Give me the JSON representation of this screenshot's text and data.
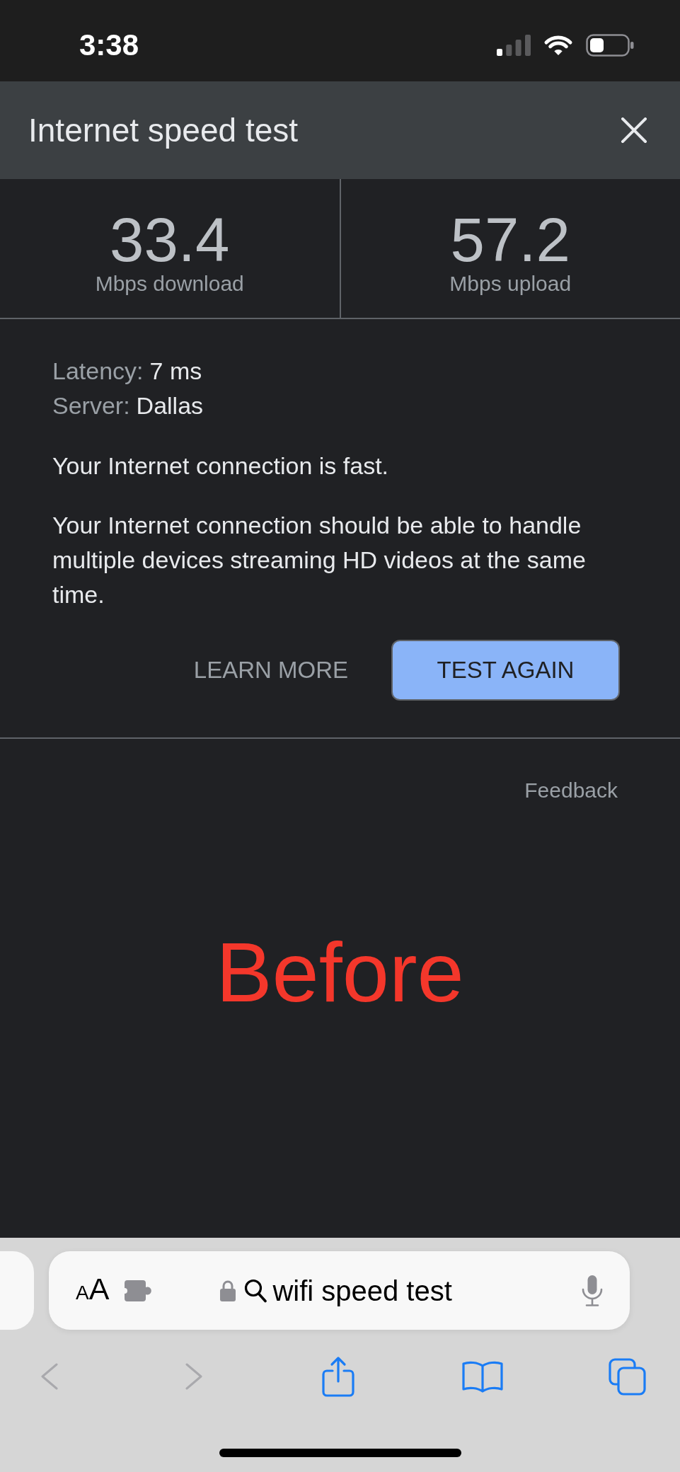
{
  "status_bar": {
    "time": "3:38"
  },
  "speed_test": {
    "title": "Internet speed test",
    "results": [
      {
        "value": "33.4",
        "unit": "Mbps download"
      },
      {
        "value": "57.2",
        "unit": "Mbps upload"
      }
    ],
    "details": [
      {
        "label": "Latency:",
        "value": "7 ms"
      },
      {
        "label": "Server:",
        "value": "Dallas"
      }
    ],
    "verdict": "Your Internet connection is fast.",
    "description": "Your Internet connection should be able to handle multiple devices streaming HD videos at the same time.",
    "buttons": [
      {
        "label": "LEARN MORE",
        "kind": "text"
      },
      {
        "label": "TEST AGAIN",
        "kind": "filled"
      }
    ],
    "feedback": "Feedback"
  },
  "annotation": "Before",
  "browser": {
    "address_bar": {
      "page_menu": "AA",
      "value": "wifi speed test"
    },
    "toolbar": [
      {
        "kind": "back",
        "disabled": true
      },
      {
        "kind": "forward",
        "disabled": true
      },
      {
        "kind": "share",
        "disabled": false
      },
      {
        "kind": "bookmarks",
        "disabled": false
      },
      {
        "kind": "tabs",
        "disabled": false
      }
    ]
  }
}
